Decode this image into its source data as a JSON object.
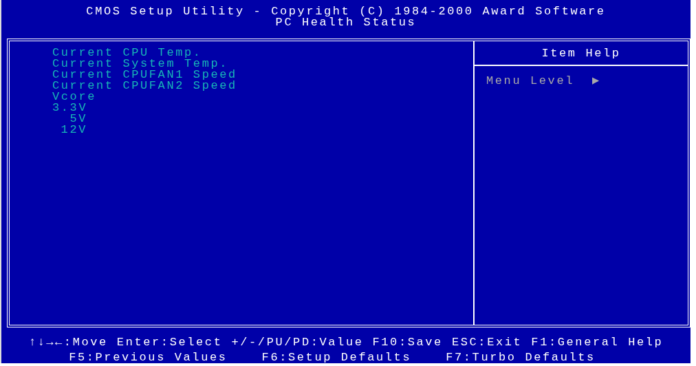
{
  "header": {
    "title": "CMOS Setup Utility - Copyright (C) 1984-2000 Award Software",
    "subtitle": "PC Health Status"
  },
  "items": [
    {
      "label": "Current CPU Temp.",
      "kind": "setting"
    },
    {
      "label": "Current System Temp.",
      "kind": "setting"
    },
    {
      "label": "Current CPUFAN1 Speed",
      "kind": "setting"
    },
    {
      "label": "Current CPUFAN2 Speed",
      "kind": "setting"
    },
    {
      "label": "Vcore",
      "kind": "setting"
    },
    {
      "label": "3.3V",
      "kind": "voltage"
    },
    {
      "label": "5V",
      "kind": "voltage"
    },
    {
      "label": "12V",
      "kind": "voltage"
    }
  ],
  "item_help": {
    "title": "Item Help",
    "menu_level": "Menu Level",
    "marker": "▶"
  },
  "footer": {
    "line_1": [
      "↑↓→←:Move",
      "Enter:Select",
      "+/-/PU/PD:Value",
      "F10:Save",
      "ESC:Exit",
      "F1:General Help"
    ],
    "line_2": [
      "F5:Previous Values",
      "F6:Setup Defaults",
      "F7:Turbo Defaults"
    ]
  }
}
